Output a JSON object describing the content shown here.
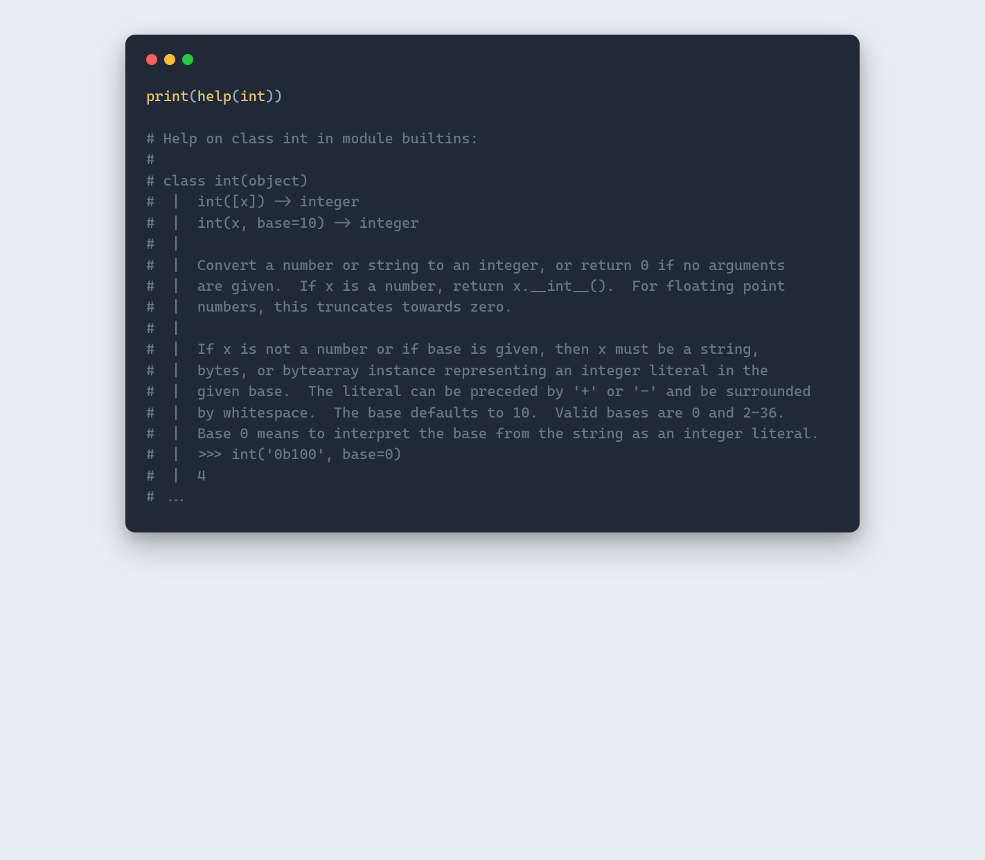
{
  "window": {
    "buttons": [
      "close",
      "minimize",
      "zoom"
    ]
  },
  "code": {
    "print_fn": "print",
    "help_fn": "help",
    "int_type": "int",
    "open_paren": "(",
    "close_paren": ")",
    "double_close": "))"
  },
  "comments": {
    "l1": "# Help on class int in module builtins:",
    "l2": "#",
    "l3": "# class int(object)",
    "l4": "#  |  int([x]) -> integer",
    "l5": "#  |  int(x, base=10) -> integer",
    "l6": "#  |",
    "l7": "#  |  Convert a number or string to an integer, or return 0 if no arguments",
    "l8": "#  |  are given.  If x is a number, return x.__int__().  For floating point",
    "l9": "#  |  numbers, this truncates towards zero.",
    "l10": "#  |",
    "l11": "#  |  If x is not a number or if base is given, then x must be a string,",
    "l12": "#  |  bytes, or bytearray instance representing an integer literal in the",
    "l13": "#  |  given base.  The literal can be preceded by '+' or '-' and be surrounded",
    "l14": "#  |  by whitespace.  The base defaults to 10.  Valid bases are 0 and 2-36.",
    "l15": "#  |  Base 0 means to interpret the base from the string as an integer literal.",
    "l16": "#  |  >>> int('0b100', base=0)",
    "l17": "#  |  4",
    "l18": "# ..."
  }
}
